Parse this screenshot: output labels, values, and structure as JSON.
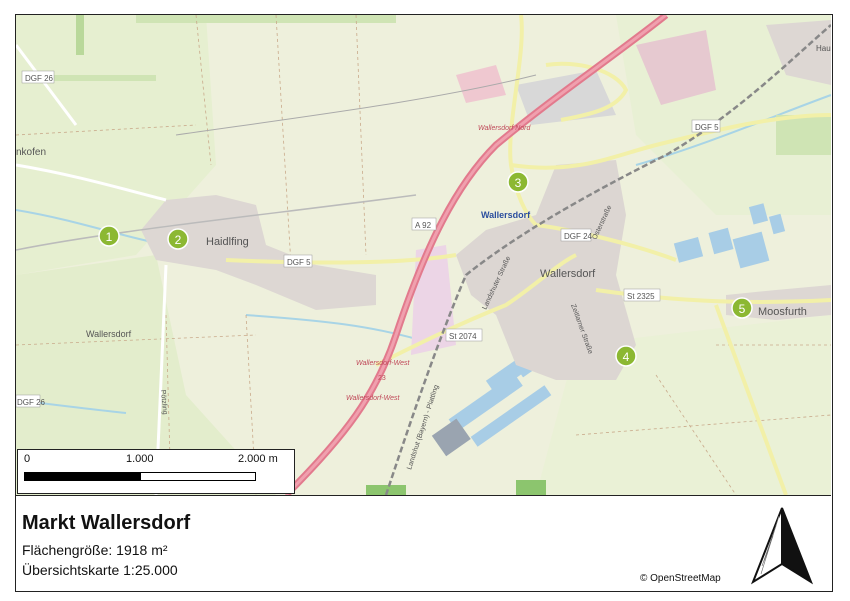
{
  "map": {
    "places": {
      "wallersdorf_main": "Wallersdorf",
      "wallersdorf_town": "Wallersdorf",
      "wallersdorf_field": "Wallersdorf",
      "haidlfing": "Haidlfing",
      "moosfurth": "Moosfurth",
      "kofen": "nkofen",
      "haum": "Haum"
    },
    "roads": {
      "dgf26_top": "DGF 26",
      "dgf26_bottom": "DGF 26",
      "dgf5_west": "DGF 5",
      "dgf5_east": "DGF 5",
      "dgf24": "DGF 24",
      "st2325": "St 2325",
      "st2074": "St 2074",
      "a92": "A 92",
      "junction_nord": "Wallersdorf Nord",
      "junction_west_1": "Wallersdorf-West",
      "junction_west_2": "Wallersdorf-West",
      "junction_num": "23",
      "landshuter": "Landshuter Straße",
      "zeitlarner": "Zeitlarner Straße",
      "ostenstr": "Osterstraße",
      "railway": "Landshut (Bayern) - Plattling",
      "pötzling": "Pötzling"
    },
    "markers": [
      {
        "num": "1"
      },
      {
        "num": "2"
      },
      {
        "num": "3"
      },
      {
        "num": "4"
      },
      {
        "num": "5"
      }
    ],
    "marker_color": "#8cb832"
  },
  "scalebar": {
    "label_0": "0",
    "label_1000": "1.000",
    "label_2000": "2.000 m"
  },
  "legend": {
    "title": "Markt Wallersdorf",
    "area_text": "Flächengröße: 1918 m²",
    "overview_text": "Übersichtskarte 1:25.000",
    "attribution": "© OpenStreetMap"
  }
}
